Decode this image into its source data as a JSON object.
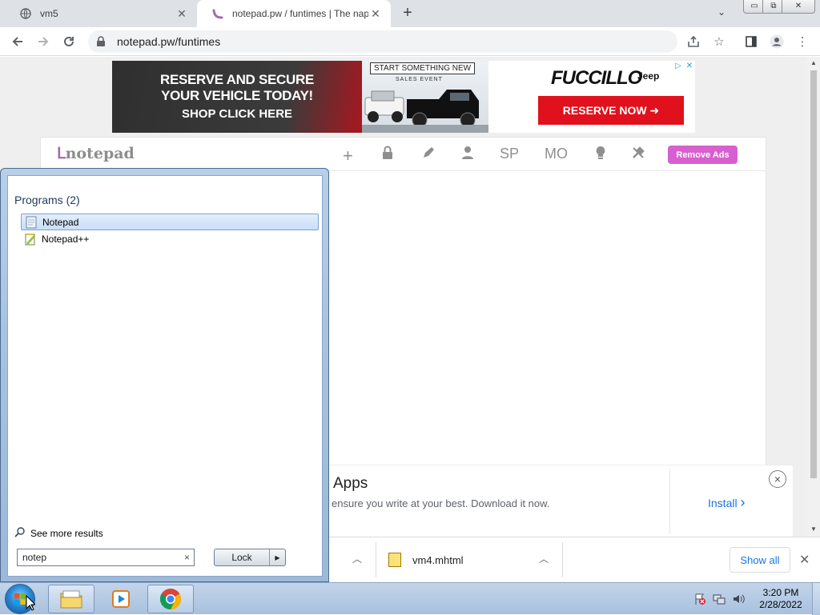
{
  "browser": {
    "tabs": [
      {
        "title": "vm5",
        "icon": "globe-icon"
      },
      {
        "title": "notepad.pw / funtimes | The napi",
        "icon": "notepad-favicon"
      }
    ],
    "new_tab": "+",
    "url": "notepad.pw/funtimes",
    "window_controls": {
      "minimize": "▭",
      "maximize": "⧉",
      "close": "✕"
    }
  },
  "ad_top": {
    "line1": "RESERVE AND SECURE",
    "line2": "YOUR VEHICLE TODAY!",
    "line3": "SHOP CLICK HERE",
    "tag": "START SOMETHING NEW",
    "sub": "SALES EVENT",
    "brand": "FUCCILLO",
    "partner": "Jeep",
    "cta": "RESERVE NOW ➜"
  },
  "notepad": {
    "logo": "notepad",
    "toolbar": [
      "+",
      "SP",
      "MO"
    ],
    "remove_ads": "Remove Ads"
  },
  "ad_bottom": {
    "title": "Apps",
    "description": "ensure you write at your best. Download it now.",
    "install": "Install",
    "install_chevron": "›",
    "close": "×"
  },
  "downloads": {
    "file": "vm4.mhtml",
    "show_all": "Show all",
    "close": "✕"
  },
  "start_menu": {
    "heading": "Programs (2)",
    "items": [
      {
        "label": "Notepad",
        "selected": true
      },
      {
        "label": "Notepad++",
        "selected": false
      }
    ],
    "see_more": "See more results",
    "search_value": "notep",
    "clear": "×",
    "lock": "Lock"
  },
  "taskbar": {
    "time": "3:20 PM",
    "date": "2/28/2022"
  },
  "colors": {
    "accent_pink": "#d85fcf",
    "ad_red": "#e0111d",
    "link_blue": "#1a73e8"
  }
}
